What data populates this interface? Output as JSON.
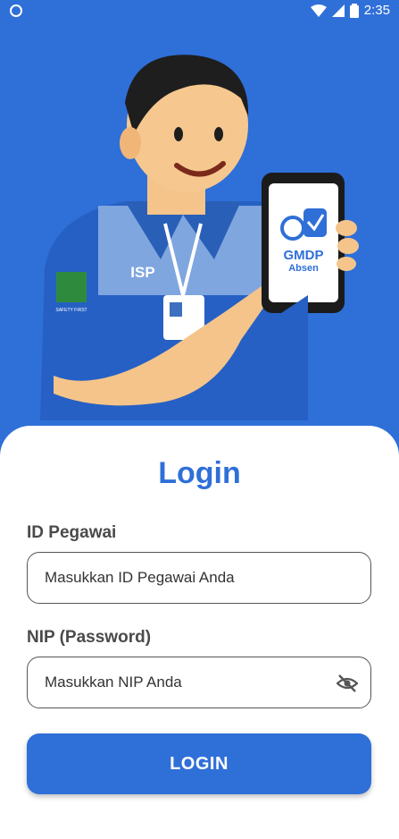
{
  "status_bar": {
    "time": "2:35"
  },
  "hero": {
    "shirt_text": "ISP",
    "phone_app_name": "GMDP",
    "phone_app_sub": "Absen",
    "badge_text": "SAFETY FIRST"
  },
  "form": {
    "title": "Login",
    "id_label": "ID Pegawai",
    "id_placeholder": "Masukkan ID Pegawai Anda",
    "nip_label": "NIP (Password)",
    "nip_placeholder": "Masukkan NIP Anda",
    "login_button": "LOGIN"
  },
  "colors": {
    "primary": "#2f6fd8",
    "background": "#ffffff"
  },
  "icons": {
    "password_toggle": "eye-off-icon"
  }
}
